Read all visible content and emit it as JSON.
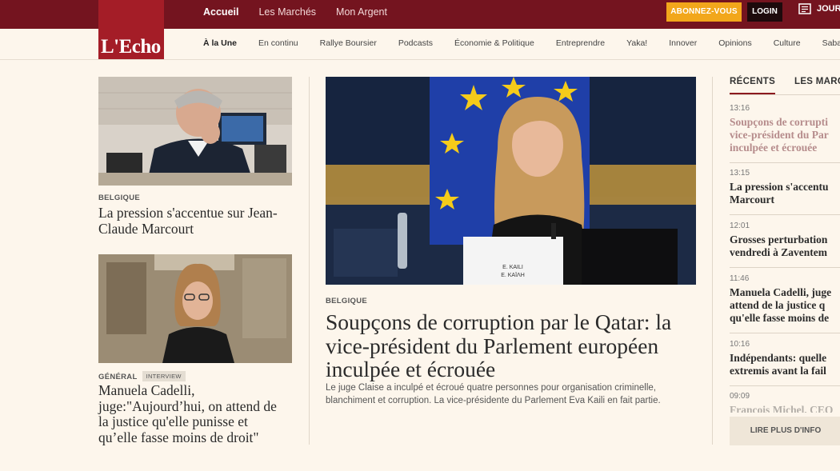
{
  "topnav": {
    "items": [
      {
        "label": "Accueil",
        "active": true
      },
      {
        "label": "Les Marchés",
        "active": false
      },
      {
        "label": "Mon Argent",
        "active": false
      }
    ],
    "subscribe_label": "ABONNEZ-VOUS",
    "login_label": "LOGIN",
    "journal_label": "JOUR",
    "journal_icon": "newspaper-icon"
  },
  "logo": {
    "text": "L'Echo",
    "color": "#a41d27"
  },
  "subnav": {
    "items": [
      "À la Une",
      "En continu",
      "Rallye Boursier",
      "Podcasts",
      "Économie & Politique",
      "Entreprendre",
      "Yaka!",
      "Innover",
      "Opinions",
      "Culture",
      "Saba"
    ],
    "active": "À la Une"
  },
  "left": {
    "article1": {
      "category": "BELGIQUE",
      "title": "La pression s'accentue sur Jean-Claude Marcourt"
    },
    "article2": {
      "category": "GÉNÉRAL",
      "badge": "INTERVIEW",
      "title": "Manuela Cadelli, juge:\"Aujourd’hui, on attend de la justice qu'elle punisse et qu’elle fasse moins de droit\""
    }
  },
  "main": {
    "category": "BELGIQUE",
    "title": "Soupçons de corruption par le Qatar: la vice-président du Parlement européen inculpée et écrouée",
    "lede": "Le juge Claise a inculpé et écroué quatre personnes pour organisation criminelle, blanchiment et corruption. La vice-présidente du Parlement Eva Kaili en fait partie.",
    "nameplate": [
      "E. KAILI",
      "Ε. ΚΑΪΛΗ"
    ]
  },
  "sidebar": {
    "tabs": [
      "RÉCENTS",
      "LES MARC"
    ],
    "items": [
      {
        "time": "13:16",
        "title_lines": [
          "Soupçons de corrupti",
          "vice-président du Par",
          "inculpée et écrouée"
        ],
        "highlight": true
      },
      {
        "time": "13:15",
        "title_lines": [
          "La pression s'accentu",
          "Marcourt"
        ],
        "highlight": false
      },
      {
        "time": "12:01",
        "title_lines": [
          "Grosses perturbation",
          "vendredi à Zaventem"
        ],
        "highlight": false
      },
      {
        "time": "11:46",
        "title_lines": [
          "Manuela Cadelli, juge",
          "attend de la justice q",
          "qu'elle fasse moins de"
        ],
        "highlight": false
      },
      {
        "time": "10:16",
        "title_lines": [
          "Indépendants: quelle",
          "extremis avant la fail"
        ],
        "highlight": false
      },
      {
        "time": "09:09",
        "title_lines": [
          "François Michel, CEO"
        ],
        "highlight": false
      }
    ],
    "more_label": "LIRE PLUS D'INFO"
  },
  "colors": {
    "topbar": "#74141f",
    "accent": "#f2a71b",
    "background": "#fdf6ec"
  }
}
